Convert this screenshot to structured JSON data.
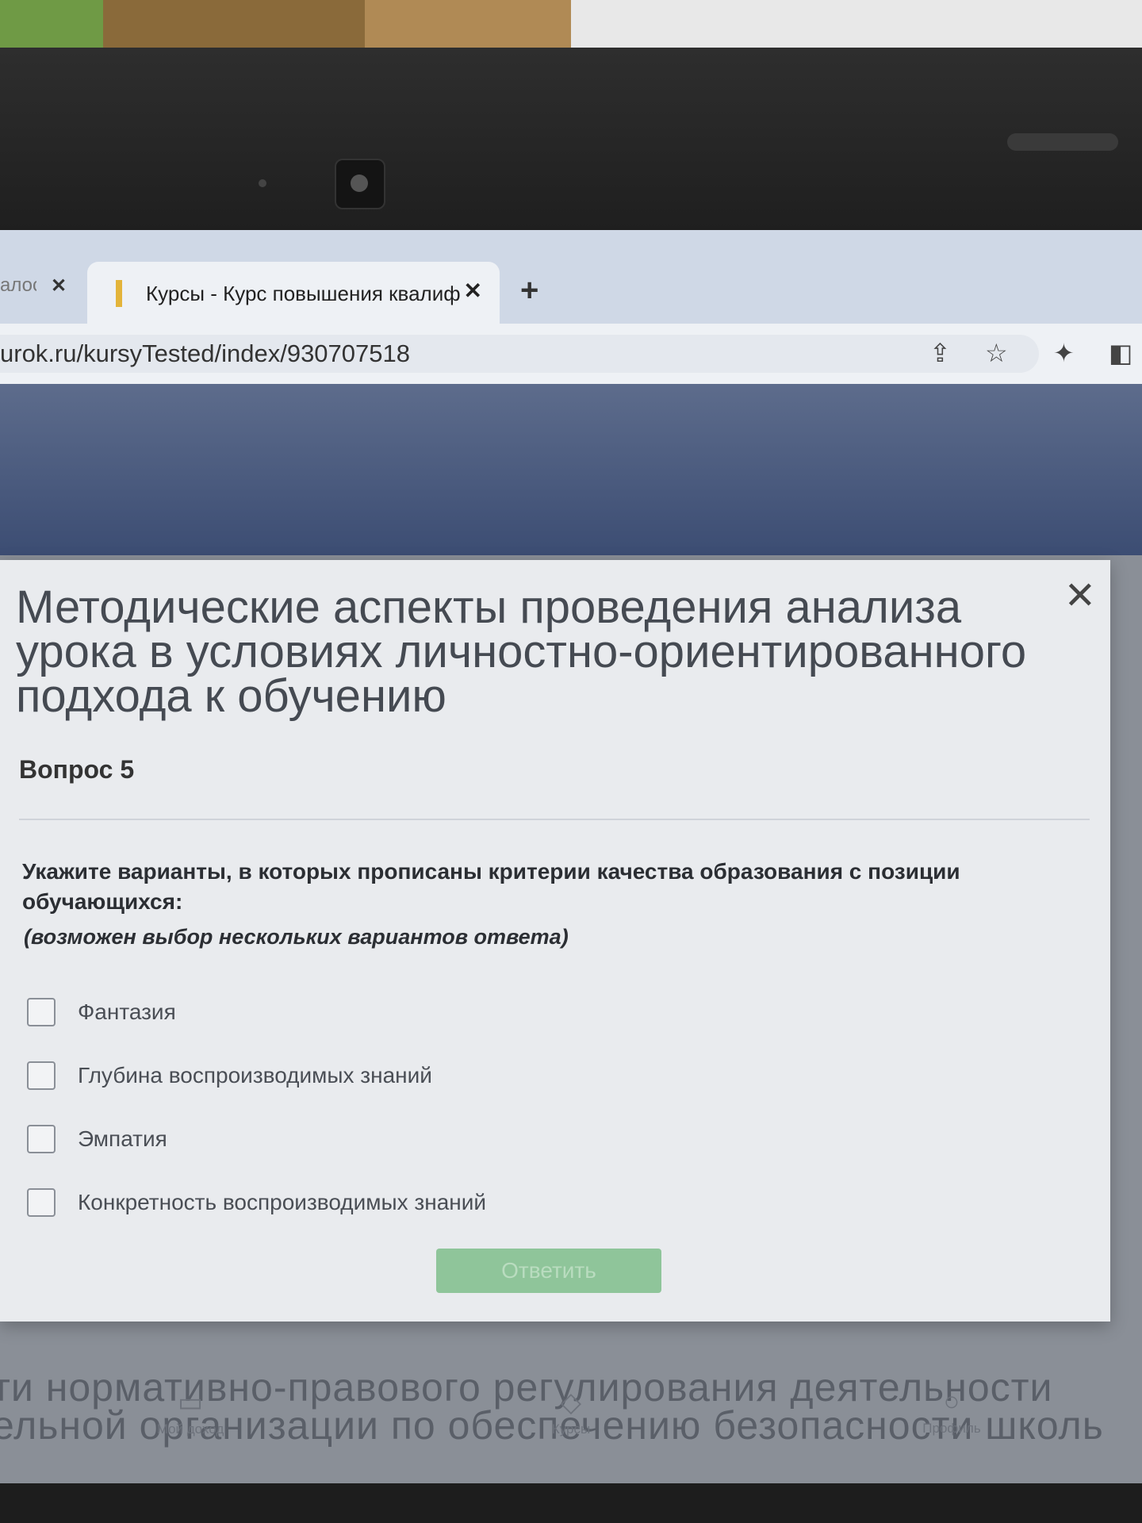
{
  "browser": {
    "prev_tab_label": "алос",
    "prev_tab_close": "✕",
    "active_tab_title": "Курсы - Курс повышения квалиф",
    "active_tab_close": "✕",
    "new_tab": "+",
    "url": "urok.ru/kursyTested/index/930707518",
    "share_icon": "⇪",
    "star_icon": "☆",
    "extensions_icon": "✦",
    "sidebar_icon": "◧"
  },
  "modal": {
    "close": "✕",
    "course_title": "Методические аспекты проведения анализа урока в условиях личностно-ориентированного подхода к обучению",
    "question_number": "Вопрос 5",
    "question_text": "Укажите варианты, в которых прописаны критерии качества образования с позиции обучающихся:",
    "question_hint": "(возможен выбор нескольких вариантов ответа)",
    "options": [
      {
        "label": "Фантазия",
        "checked": false
      },
      {
        "label": "Глубина воспроизводимых знаний",
        "checked": false
      },
      {
        "label": "Эмпатия",
        "checked": false
      },
      {
        "label": "Конкретность воспроизводимых знаний",
        "checked": false
      }
    ],
    "submit_label": "Ответить",
    "submit_color": "#8fc59a"
  },
  "background_page": {
    "line1": "ти нормативно-правового регулирования деятельности",
    "line2": "ельной организации по обеспечению безопасности школь"
  },
  "bottom_nav": {
    "items": [
      {
        "label": "Мой доход",
        "icon": "wallet-icon"
      },
      {
        "label": "Курсы",
        "icon": "graduation-cap-icon"
      },
      {
        "label": "Профиль",
        "icon": "user-icon"
      }
    ]
  }
}
